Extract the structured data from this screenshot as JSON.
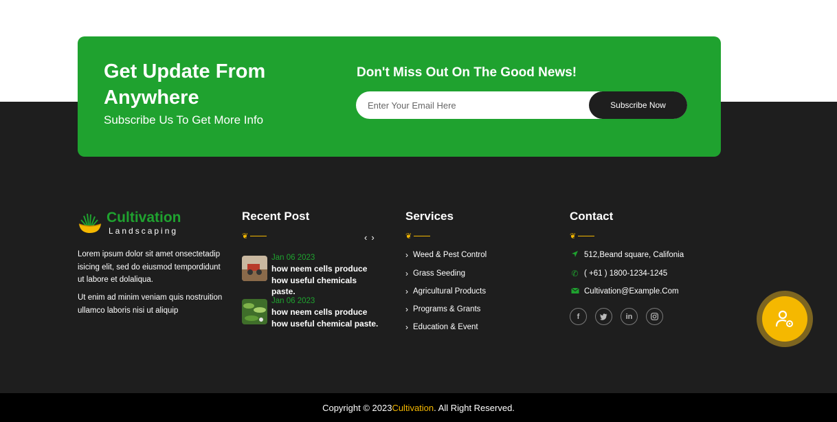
{
  "newsletter": {
    "title": "Get Update From Anywhere",
    "subtitle": "Subscribe Us To Get More Info",
    "right_title": "Don't Miss Out On The Good News!",
    "email_placeholder": "Enter Your Email Here",
    "subscribe_label": "Subscribe Now",
    "bg_color": "#1fa22f"
  },
  "brand": {
    "name": "Cultivation",
    "tagline": "Landscaping",
    "about_1": "Lorem ipsum dolor sit amet onsectetadip isicing elit, sed do eiusmod tempordidunt ut labore et dolaliqua.",
    "about_2": "Ut enim ad minim veniam quis nostruition ullamco laboris nisi ut aliquip"
  },
  "recent_posts": {
    "title": "Recent Post",
    "items": [
      {
        "date": "Jan 06 2023",
        "title": "how neem cells produce how useful chemicals paste."
      },
      {
        "date": "Jan 06 2023",
        "title": "how neem cells produce how useful chemical paste."
      }
    ]
  },
  "services": {
    "title": "Services",
    "items": [
      "Weed & Pest Control",
      "Grass Seeding",
      "Agricultural Products",
      "Programs & Grants",
      "Education & Event"
    ]
  },
  "contact": {
    "title": "Contact",
    "address": "512,Beand square, Califonia",
    "phone": "( +61 ) 1800-1234-1245",
    "email": "Cultivation@Example.Com",
    "socials": [
      "facebook-icon",
      "twitter-icon",
      "linkedin-icon",
      "instagram-icon"
    ]
  },
  "footer": {
    "copyright_prefix": "Copyright © 2023 ",
    "copyright_brand": "Cultivation",
    "copyright_suffix": ". All Right Reserved."
  },
  "colors": {
    "accent_green": "#1fa22f",
    "accent_gold": "#f5b800",
    "dark_bg": "#1e1e1e"
  }
}
